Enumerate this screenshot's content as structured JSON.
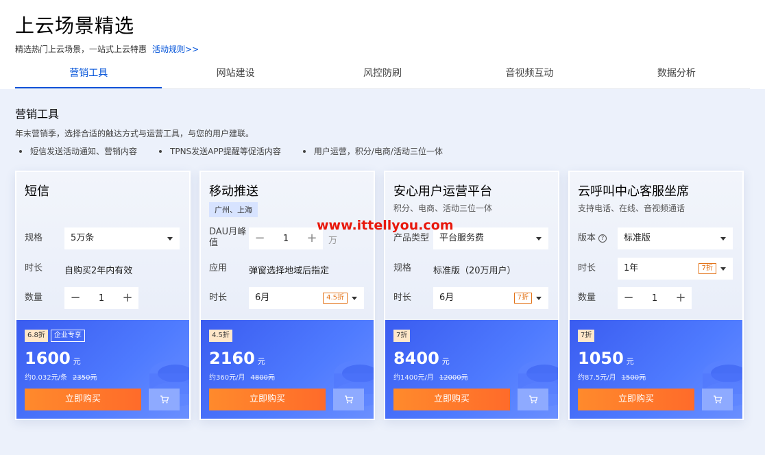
{
  "header": {
    "title": "上云场景精选",
    "subtitle": "精选热门上云场景，一站式上云特惠",
    "rules_link": "活动规则>>"
  },
  "tabs": [
    {
      "label": "营销工具",
      "active": true
    },
    {
      "label": "网站建设",
      "active": false
    },
    {
      "label": "风控防刷",
      "active": false
    },
    {
      "label": "音视频互动",
      "active": false
    },
    {
      "label": "数据分析",
      "active": false
    }
  ],
  "section": {
    "title": "营销工具",
    "desc": "年末营销季，选择合适的触达方式与运营工具，与您的用户建联。",
    "bullets": [
      "短信发送活动通知、营销内容",
      "TPNS发送APP提醒等促活内容",
      "用户运营，积分/电商/活动三位一体"
    ]
  },
  "watermark": "www.ittellyou.com",
  "cards": [
    {
      "name": "短信",
      "spec_label": "规格",
      "spec_value": "5万条",
      "duration_label": "时长",
      "duration_value": "自购买2年内有效",
      "qty_label": "数量",
      "qty_value": "1",
      "discount": "6.8折",
      "enterprise": "企业专享",
      "price": "1600",
      "unit": "元",
      "per": "约0.032元/条",
      "orig": "2350元",
      "buy": "立即购买"
    },
    {
      "name": "移动推送",
      "region": "广州、上海",
      "dau_label": "DAU月峰值",
      "dau_value": "1",
      "dau_unit": "万",
      "app_label": "应用",
      "app_value": "弹窗选择地域后指定",
      "duration_label": "时长",
      "duration_value": "6月",
      "duration_disc": "4.5折",
      "discount": "4.5折",
      "price": "2160",
      "unit": "元",
      "per": "约360元/月",
      "orig": "4800元",
      "buy": "立即购买"
    },
    {
      "name": "安心用户运营平台",
      "sub": "积分、电商、活动三位一体",
      "type_label": "产品类型",
      "type_value": "平台服务费",
      "spec_label": "规格",
      "spec_value": "标准版（20万用户）",
      "duration_label": "时长",
      "duration_value": "6月",
      "duration_disc": "7折",
      "discount": "7折",
      "price": "8400",
      "unit": "元",
      "per": "约1400元/月",
      "orig": "12000元",
      "buy": "立即购买"
    },
    {
      "name": "云呼叫中心客服坐席",
      "sub": "支持电话、在线、音视频通话",
      "version_label": "版本",
      "version_value": "标准版",
      "duration_label": "时长",
      "duration_value": "1年",
      "duration_disc": "7折",
      "qty_label": "数量",
      "qty_value": "1",
      "discount": "7折",
      "price": "1050",
      "unit": "元",
      "per": "约87.5元/月",
      "orig": "1500元",
      "buy": "立即购买"
    }
  ]
}
